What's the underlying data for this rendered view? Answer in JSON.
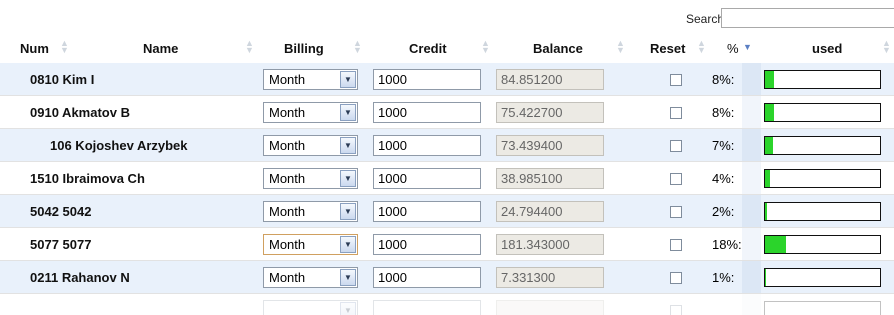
{
  "search": {
    "label": "Search:",
    "value": ""
  },
  "columns": {
    "num": "Num",
    "name": "Name",
    "billing": "Billing",
    "credit": "Credit",
    "balance": "Balance",
    "reset": "Reset",
    "pct": "%",
    "used": "used"
  },
  "colors": {
    "bar_fill": "#2bd42b",
    "row_stripe": "#e9f1fb",
    "sort_active": "#5b7fc3"
  },
  "rows": [
    {
      "name": "0810 Kim I",
      "billing": "Month",
      "credit": "1000",
      "balance": "84.851200",
      "reset": false,
      "pct": "8%:",
      "used": 0.08
    },
    {
      "name": "0910 Akmatov B",
      "billing": "Month",
      "credit": "1000",
      "balance": "75.422700",
      "reset": false,
      "pct": "8%:",
      "used": 0.08
    },
    {
      "name": "106 Kojoshev Arzybek",
      "billing": "Month",
      "credit": "1000",
      "balance": "73.439400",
      "reset": false,
      "pct": "7%:",
      "used": 0.07
    },
    {
      "name": "1510 Ibraimova Ch",
      "billing": "Month",
      "credit": "1000",
      "balance": "38.985100",
      "reset": false,
      "pct": "4%:",
      "used": 0.04
    },
    {
      "name": "5042 5042",
      "billing": "Month",
      "credit": "1000",
      "balance": "24.794400",
      "reset": false,
      "pct": "2%:",
      "used": 0.02
    },
    {
      "name": "5077 5077",
      "billing": "Month",
      "credit": "1000",
      "balance": "181.343000",
      "reset": false,
      "pct": "18%:",
      "used": 0.18
    },
    {
      "name": "0211 Rahanov N",
      "billing": "Month",
      "credit": "1000",
      "balance": "7.331300",
      "reset": false,
      "pct": "1%:",
      "used": 0.01
    }
  ]
}
